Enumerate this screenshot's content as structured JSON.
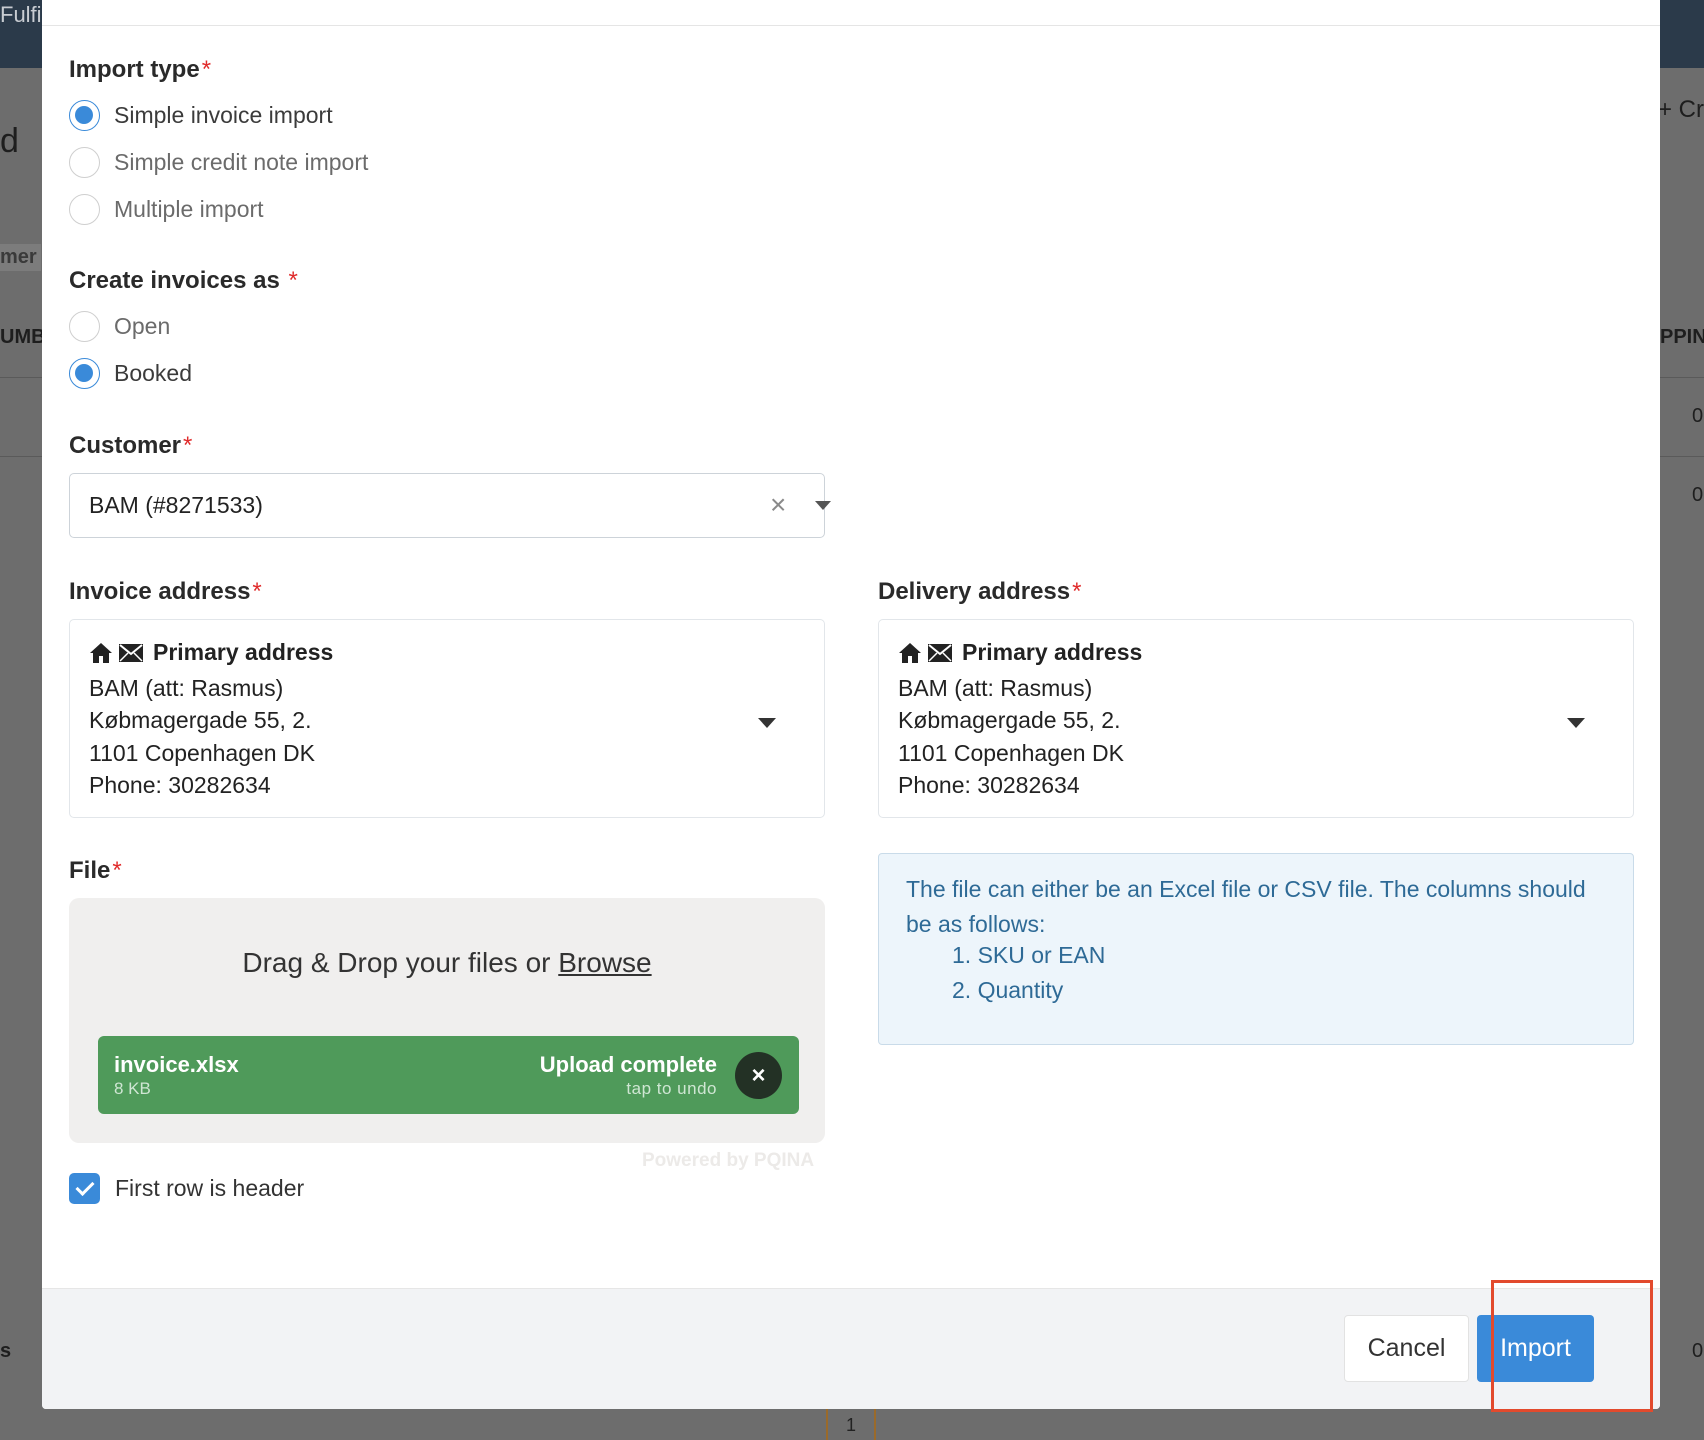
{
  "background": {
    "top_bar_text": "Fulfill",
    "side_letter": "d",
    "right_button_text": "+ Cr",
    "left_chip_text": "mer",
    "left_column_header": "UMBI",
    "right_column_header": "PPIN",
    "right_cell_1": "0",
    "right_cell_2": "0",
    "left_footer_text": "s",
    "right_footer_text": "0",
    "pager_number": "1"
  },
  "import_type": {
    "label": "Import type",
    "required_mark": "*",
    "options": [
      {
        "label": "Simple invoice import",
        "checked": true
      },
      {
        "label": "Simple credit note import",
        "checked": false
      },
      {
        "label": "Multiple import",
        "checked": false
      }
    ]
  },
  "create_as": {
    "label": "Create invoices as",
    "required_mark": "*",
    "options": [
      {
        "label": "Open",
        "checked": false
      },
      {
        "label": "Booked",
        "checked": true
      }
    ]
  },
  "customer": {
    "label": "Customer",
    "required_mark": "*",
    "value": "BAM (#8271533)",
    "clear_glyph": "×"
  },
  "invoice_address": {
    "label": "Invoice address",
    "required_mark": "*",
    "title": "Primary address",
    "lines": [
      "BAM (att: Rasmus)",
      "Købmagergade 55, 2.",
      "1101 Copenhagen DK",
      "Phone: 30282634"
    ]
  },
  "delivery_address": {
    "label": "Delivery address",
    "required_mark": "*",
    "title": "Primary address",
    "lines": [
      "BAM (att: Rasmus)",
      "Købmagergade 55, 2.",
      "1101 Copenhagen DK",
      "Phone: 30282634"
    ]
  },
  "file": {
    "label": "File",
    "required_mark": "*",
    "drop_text": "Drag & Drop your files or ",
    "browse_text": "Browse",
    "item": {
      "name": "invoice.xlsx",
      "size": "8 KB",
      "status": "Upload complete",
      "undo": "tap to undo",
      "remove_glyph": "×"
    },
    "powered_by": "Powered by PQINA"
  },
  "info": {
    "text": "The file can either be an Excel file or CSV file. The columns should be as follows:",
    "items": [
      "1. SKU or EAN",
      "2. Quantity"
    ]
  },
  "first_row_header": {
    "label": "First row is header",
    "checked": true
  },
  "footer": {
    "cancel_label": "Cancel",
    "import_label": "Import"
  },
  "colors": {
    "accent": "#3a8ad9",
    "upload_success": "#4f9a5a",
    "required": "#e02b2b",
    "highlight": "#e24a2d",
    "info_text": "#2e6a96"
  }
}
